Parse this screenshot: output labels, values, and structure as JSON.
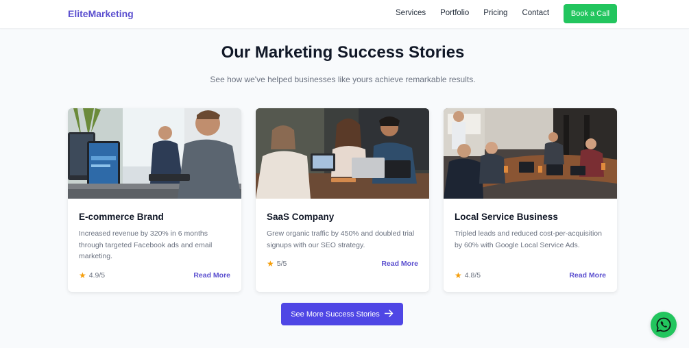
{
  "nav": {
    "brand": "EliteMarketing",
    "links": [
      "Services",
      "Portfolio",
      "Pricing",
      "Contact"
    ],
    "cta": "Book a Call"
  },
  "hero": {
    "title": "Our Marketing Success Stories",
    "subtitle": "See how we've helped businesses like yours achieve remarkable results."
  },
  "cards": [
    {
      "title": "E-commerce Brand",
      "description": "Increased revenue by 320% in 6 months through targeted Facebook ads and email marketing.",
      "rating": "4.9/5",
      "link": "Read More"
    },
    {
      "title": "SaaS Company",
      "description": "Grew organic traffic by 450% and doubled trial signups with our SEO strategy.",
      "rating": "5/5",
      "link": "Read More"
    },
    {
      "title": "Local Service Business",
      "description": "Tripled leads and reduced cost-per-acquisition by 60% with Google Local Service Ads.",
      "rating": "4.8/5",
      "link": "Read More"
    }
  ],
  "see_more": {
    "label": "See More Success Stories",
    "icon": "arrow-right-icon"
  },
  "whatsapp": {
    "icon": "whatsapp-icon"
  },
  "colors": {
    "brand": "#5b4fcf",
    "cta": "#22c55e",
    "primary_button": "#4f46e5",
    "star": "#f59e0b"
  }
}
